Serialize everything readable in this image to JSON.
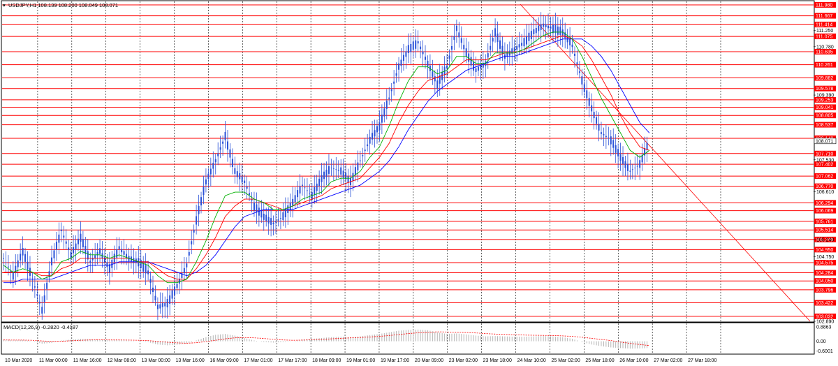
{
  "chart_data": {
    "type": "line",
    "symbol_header": "USDJPY,H1  108.139 108.200 108.049 108.071",
    "macd_header": "MACD(12,26,9) -0.2820 -0.4187",
    "price_axis": {
      "ylim": [
        102.89,
        112.08
      ],
      "ticks": [
        "111.250",
        "110.780",
        "109.390",
        "107.530",
        "106.610",
        "105.240",
        "104.750",
        "102.890"
      ]
    },
    "macd_axis": {
      "ylim": [
        -0.75,
        1.1
      ],
      "ticks": [
        "0.8863",
        "0.00",
        "-0.6001"
      ]
    },
    "x_labels": [
      "10 Mar 2020",
      "11 Mar 00:00",
      "11 Mar 16:00",
      "12 Mar 08:00",
      "13 Mar 00:00",
      "13 Mar 16:00",
      "16 Mar 09:00",
      "17 Mar 01:00",
      "17 Mar 17:00",
      "18 Mar 09:00",
      "19 Mar 01:00",
      "19 Mar 17:00",
      "20 Mar 09:00",
      "23 Mar 02:00",
      "23 Mar 18:00",
      "24 Mar 10:00",
      "25 Mar 02:00",
      "25 Mar 18:00",
      "26 Mar 10:00",
      "27 Mar 02:00",
      "27 Mar 18:00"
    ],
    "levels": [
      {
        "label": "111.980",
        "value": 111.98
      },
      {
        "label": "111.667",
        "value": 111.667
      },
      {
        "label": "111.414",
        "value": 111.414
      },
      {
        "label": "111.075",
        "value": 111.075
      },
      {
        "label": "110.635",
        "value": 110.635
      },
      {
        "label": "110.261",
        "value": 110.261
      },
      {
        "label": "109.882",
        "value": 109.882
      },
      {
        "label": "109.578",
        "value": 109.578
      },
      {
        "label": "109.253",
        "value": 109.253
      },
      {
        "label": "109.041",
        "value": 109.041
      },
      {
        "label": "108.805",
        "value": 108.805
      },
      {
        "label": "108.537",
        "value": 108.537
      },
      {
        "label": "108.148",
        "value": 108.148
      },
      {
        "label": "107.710",
        "value": 107.71
      },
      {
        "label": "107.402",
        "value": 107.402
      },
      {
        "label": "107.062",
        "value": 107.062
      },
      {
        "label": "106.770",
        "value": 106.77
      },
      {
        "label": "106.294",
        "value": 106.294
      },
      {
        "label": "106.069",
        "value": 106.069
      },
      {
        "label": "105.761",
        "value": 105.761
      },
      {
        "label": "105.514",
        "value": 105.514
      },
      {
        "label": "105.240",
        "value": 105.24
      },
      {
        "label": "104.950",
        "value": 104.95
      },
      {
        "label": "104.575",
        "value": 104.575
      },
      {
        "label": "104.284",
        "value": 104.284
      },
      {
        "label": "104.050",
        "value": 104.05
      },
      {
        "label": "103.796",
        "value": 103.796
      },
      {
        "label": "103.422",
        "value": 103.422
      },
      {
        "label": "103.032",
        "value": 103.032
      }
    ],
    "current_price": {
      "label": "108.071",
      "value": 108.071
    },
    "price_path": [
      104.7,
      104.2,
      104.9,
      104.1,
      103.2,
      104.6,
      105.5,
      104.8,
      105.3,
      104.6,
      104.9,
      104.4,
      105.0,
      104.7,
      104.6,
      104.3,
      103.3,
      103.4,
      103.9,
      104.5,
      105.8,
      106.9,
      107.5,
      108.2,
      107.2,
      106.9,
      106.2,
      105.9,
      105.7,
      105.9,
      106.3,
      106.8,
      106.5,
      107.0,
      107.3,
      107.2,
      106.9,
      107.5,
      108.1,
      108.5,
      109.3,
      110.2,
      110.7,
      110.9,
      110.3,
      109.7,
      110.2,
      111.3,
      110.6,
      110.1,
      110.3,
      111.2,
      110.5,
      110.7,
      110.9,
      111.2,
      111.4,
      111.3,
      111.2,
      110.8,
      109.8,
      109.0,
      108.3,
      108.1,
      107.6,
      107.2,
      107.4,
      108.1
    ],
    "ma_green": [
      104.5,
      104.3,
      104.4,
      104.3,
      104.1,
      104.2,
      104.6,
      104.7,
      104.9,
      104.8,
      104.8,
      104.7,
      104.8,
      104.7,
      104.6,
      104.5,
      104.2,
      104.0,
      104.0,
      104.1,
      104.6,
      105.2,
      105.9,
      106.5,
      106.6,
      106.6,
      106.4,
      106.3,
      106.1,
      106.1,
      106.2,
      106.4,
      106.5,
      106.6,
      106.9,
      107.0,
      107.0,
      107.2,
      107.6,
      107.9,
      108.5,
      109.2,
      109.8,
      110.2,
      110.2,
      110.0,
      110.1,
      110.5,
      110.5,
      110.3,
      110.3,
      110.6,
      110.6,
      110.6,
      110.7,
      110.9,
      111.1,
      111.2,
      111.2,
      111.0,
      110.5,
      109.9,
      109.3,
      108.8,
      108.3,
      107.8,
      107.6,
      107.8
    ],
    "ma_red": [
      104.3,
      104.3,
      104.3,
      104.3,
      104.2,
      104.2,
      104.4,
      104.5,
      104.7,
      104.7,
      104.7,
      104.7,
      104.7,
      104.7,
      104.6,
      104.6,
      104.4,
      104.2,
      104.1,
      104.1,
      104.4,
      104.8,
      105.3,
      105.9,
      106.2,
      106.4,
      106.4,
      106.3,
      106.2,
      106.1,
      106.2,
      106.3,
      106.4,
      106.5,
      106.7,
      106.8,
      106.9,
      107.0,
      107.3,
      107.6,
      108.0,
      108.6,
      109.1,
      109.5,
      109.8,
      109.9,
      110.0,
      110.2,
      110.4,
      110.4,
      110.4,
      110.5,
      110.6,
      110.6,
      110.7,
      110.8,
      110.9,
      111.0,
      111.1,
      111.0,
      110.8,
      110.4,
      109.9,
      109.4,
      108.8,
      108.3,
      107.9,
      107.8
    ],
    "ma_blue": [
      104.0,
      104.0,
      104.1,
      104.1,
      104.1,
      104.1,
      104.2,
      104.3,
      104.4,
      104.5,
      104.5,
      104.5,
      104.6,
      104.6,
      104.6,
      104.6,
      104.5,
      104.4,
      104.3,
      104.2,
      104.3,
      104.5,
      104.8,
      105.2,
      105.6,
      105.9,
      106.0,
      106.1,
      106.1,
      106.1,
      106.1,
      106.2,
      106.3,
      106.4,
      106.5,
      106.6,
      106.7,
      106.8,
      107.0,
      107.2,
      107.5,
      107.9,
      108.4,
      108.8,
      109.2,
      109.5,
      109.7,
      109.9,
      110.1,
      110.2,
      110.3,
      110.4,
      110.5,
      110.5,
      110.6,
      110.7,
      110.8,
      110.9,
      111.0,
      111.0,
      111.0,
      110.8,
      110.5,
      110.1,
      109.6,
      109.1,
      108.6,
      108.3
    ],
    "trendline": {
      "from": 112.0,
      "to": 102.89
    },
    "macd_values": [
      0.1,
      0.05,
      0.08,
      0.0,
      -0.15,
      -0.1,
      0.05,
      0.1,
      0.15,
      0.12,
      0.1,
      0.05,
      0.08,
      0.04,
      0.0,
      -0.05,
      -0.2,
      -0.25,
      -0.22,
      -0.15,
      0.05,
      0.25,
      0.4,
      0.45,
      0.35,
      0.2,
      0.05,
      -0.05,
      -0.08,
      -0.05,
      0.0,
      0.1,
      0.15,
      0.2,
      0.25,
      0.28,
      0.25,
      0.3,
      0.38,
      0.45,
      0.55,
      0.65,
      0.7,
      0.72,
      0.68,
      0.55,
      0.45,
      0.48,
      0.42,
      0.35,
      0.3,
      0.32,
      0.3,
      0.28,
      0.28,
      0.3,
      0.32,
      0.3,
      0.25,
      0.15,
      -0.05,
      -0.2,
      -0.3,
      -0.38,
      -0.42,
      -0.45,
      -0.44,
      -0.42
    ],
    "macd_signal": [
      0.08,
      0.07,
      0.07,
      0.06,
      0.02,
      -0.01,
      0.0,
      0.03,
      0.06,
      0.08,
      0.09,
      0.08,
      0.08,
      0.07,
      0.06,
      0.04,
      -0.01,
      -0.06,
      -0.1,
      -0.12,
      -0.09,
      -0.02,
      0.06,
      0.15,
      0.21,
      0.23,
      0.21,
      0.17,
      0.12,
      0.08,
      0.06,
      0.07,
      0.09,
      0.12,
      0.15,
      0.18,
      0.21,
      0.23,
      0.26,
      0.3,
      0.35,
      0.41,
      0.47,
      0.52,
      0.56,
      0.58,
      0.57,
      0.56,
      0.54,
      0.51,
      0.47,
      0.44,
      0.42,
      0.4,
      0.38,
      0.37,
      0.36,
      0.35,
      0.33,
      0.3,
      0.25,
      0.18,
      0.11,
      0.04,
      -0.05,
      -0.13,
      -0.2,
      -0.27
    ],
    "colors": {
      "level_line": "#ff0000",
      "level_label_bg": "#ff0000",
      "candle": "#2a52d8",
      "ma_green": "#00b000",
      "ma_red": "#ff0000",
      "ma_blue": "#0000ff",
      "trendline": "#ff0000",
      "macd_hist": "#b4b4b4",
      "macd_signal": "#ff0000",
      "grid": "#000000",
      "current_price_bg": "#ffffff"
    }
  }
}
